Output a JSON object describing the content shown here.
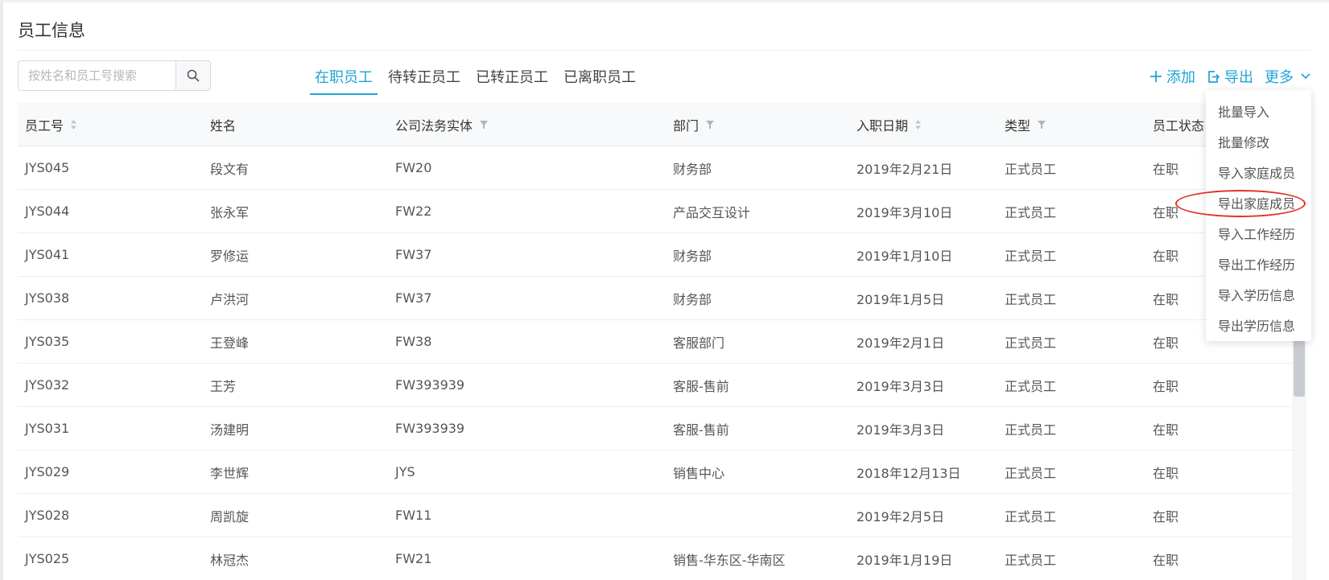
{
  "page": {
    "title": "员工信息"
  },
  "search": {
    "placeholder": "按姓名和员工号搜索",
    "value": ""
  },
  "tabs": [
    {
      "label": "在职员工",
      "active": true
    },
    {
      "label": "待转正员工",
      "active": false
    },
    {
      "label": "已转正员工",
      "active": false
    },
    {
      "label": "已离职员工",
      "active": false
    }
  ],
  "actions": {
    "add_label": "添加",
    "export_label": "导出",
    "more_label": "更多"
  },
  "colors": {
    "accent": "#1fa3d6",
    "highlight": "#e2302a"
  },
  "table": {
    "columns": [
      "员工号",
      "姓名",
      "公司法务实体",
      "部门",
      "入职日期",
      "类型",
      "员工状态"
    ],
    "rows": [
      [
        "JYS045",
        "段文有",
        "FW20",
        "财务部",
        "2019年2月21日",
        "正式员工",
        "在职"
      ],
      [
        "JYS044",
        "张永军",
        "FW22",
        "产品交互设计",
        "2019年3月10日",
        "正式员工",
        "在职"
      ],
      [
        "JYS041",
        "罗修运",
        "FW37",
        "财务部",
        "2019年1月10日",
        "正式员工",
        "在职"
      ],
      [
        "JYS038",
        "卢洪河",
        "FW37",
        "财务部",
        "2019年1月5日",
        "正式员工",
        "在职"
      ],
      [
        "JYS035",
        "王登峰",
        "FW38",
        "客服部门",
        "2019年2月1日",
        "正式员工",
        "在职"
      ],
      [
        "JYS032",
        "王芳",
        "FW393939",
        "客服-售前",
        "2019年3月3日",
        "正式员工",
        "在职"
      ],
      [
        "JYS031",
        "汤建明",
        "FW393939",
        "客服-售前",
        "2019年3月3日",
        "正式员工",
        "在职"
      ],
      [
        "JYS029",
        "李世辉",
        "JYS",
        "销售中心",
        "2018年12月13日",
        "正式员工",
        "在职"
      ],
      [
        "JYS028",
        "周凯旋",
        "FW11",
        "",
        "2019年2月5日",
        "正式员工",
        "在职"
      ],
      [
        "JYS025",
        "林冠杰",
        "FW21",
        "销售-华东区-华南区",
        "2019年1月19日",
        "正式员工",
        "在职"
      ]
    ]
  },
  "more_menu": {
    "items": [
      "批量导入",
      "批量修改",
      "导入家庭成员",
      "导出家庭成员",
      "导入工作经历",
      "导出工作经历",
      "导入学历信息",
      "导出学历信息"
    ]
  }
}
